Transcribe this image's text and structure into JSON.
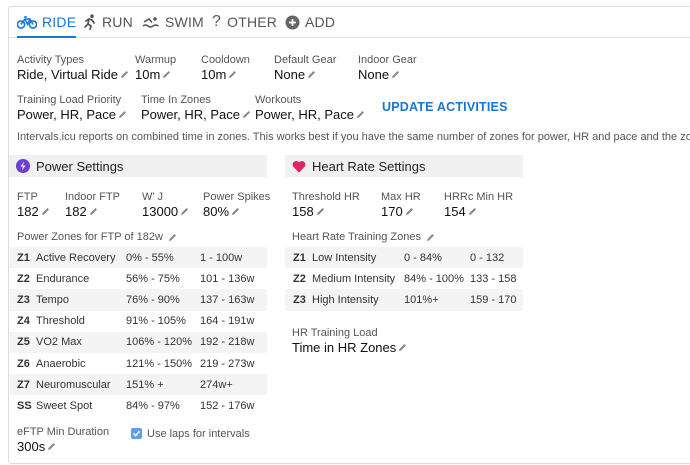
{
  "tabs": [
    {
      "label": "RIDE",
      "icon": "bike-icon",
      "active": true
    },
    {
      "label": "RUN",
      "icon": "run-icon",
      "active": false
    },
    {
      "label": "SWIM",
      "icon": "swim-icon",
      "active": false
    },
    {
      "label": "OTHER",
      "icon": "question-icon",
      "active": false
    },
    {
      "label": "ADD",
      "icon": "add-circle-icon",
      "active": false
    }
  ],
  "settings": {
    "activity_types": {
      "label": "Activity Types",
      "value": "Ride, Virtual Ride"
    },
    "warmup": {
      "label": "Warmup",
      "value": "10m"
    },
    "cooldown": {
      "label": "Cooldown",
      "value": "10m"
    },
    "default_gear": {
      "label": "Default Gear",
      "value": "None"
    },
    "indoor_gear": {
      "label": "Indoor Gear",
      "value": "None"
    },
    "training_load_priority": {
      "label": "Training Load Priority",
      "value": "Power, HR, Pace"
    },
    "time_in_zones": {
      "label": "Time In Zones",
      "value": "Power, HR, Pace"
    },
    "workouts": {
      "label": "Workouts",
      "value": "Power, HR, Pace"
    },
    "update_button": "UPDATE ACTIVITIES",
    "info_text": "Intervals.icu reports on combined time in zones. This works best if you have the same number of zones for power, HR and pace and the zones are cor"
  },
  "power": {
    "title": "Power Settings",
    "ftp": {
      "label": "FTP",
      "value": "182"
    },
    "indoor_ftp": {
      "label": "Indoor FTP",
      "value": "182"
    },
    "w_prime": {
      "label": "W' J",
      "value": "13000"
    },
    "power_spikes": {
      "label": "Power Spikes",
      "value": "80%"
    },
    "zones_label": "Power Zones for FTP of 182w",
    "zones": [
      {
        "id": "Z1",
        "name": "Active Recovery",
        "pct": "0% - 55%",
        "watts": "1 - 100w"
      },
      {
        "id": "Z2",
        "name": "Endurance",
        "pct": "56% - 75%",
        "watts": "101 - 136w"
      },
      {
        "id": "Z3",
        "name": "Tempo",
        "pct": "76% - 90%",
        "watts": "137 - 163w"
      },
      {
        "id": "Z4",
        "name": "Threshold",
        "pct": "91% - 105%",
        "watts": "164 - 191w"
      },
      {
        "id": "Z5",
        "name": "VO2 Max",
        "pct": "106% - 120%",
        "watts": "192 - 218w"
      },
      {
        "id": "Z6",
        "name": "Anaerobic",
        "pct": "121% - 150%",
        "watts": "219 - 273w"
      },
      {
        "id": "Z7",
        "name": "Neuromuscular",
        "pct": "151% +",
        "watts": "274w+"
      },
      {
        "id": "SS",
        "name": "Sweet Spot",
        "pct": "84% - 97%",
        "watts": "152 - 176w"
      }
    ],
    "eftp": {
      "label": "eFTP Min Duration",
      "value": "300s"
    },
    "use_laps": {
      "label": "Use laps for intervals",
      "checked": true
    }
  },
  "hr": {
    "title": "Heart Rate Settings",
    "threshold": {
      "label": "Threshold HR",
      "value": "158"
    },
    "max": {
      "label": "Max HR",
      "value": "170"
    },
    "hrrc": {
      "label": "HRRc Min HR",
      "value": "154"
    },
    "zones_label": "Heart Rate Training Zones",
    "zones": [
      {
        "id": "Z1",
        "name": "Low Intensity",
        "pct": "0 - 84%",
        "bpm": "0 - 132"
      },
      {
        "id": "Z2",
        "name": "Medium Intensity",
        "pct": "84% - 100%",
        "bpm": "133 - 158"
      },
      {
        "id": "Z3",
        "name": "High Intensity",
        "pct": "101%+",
        "bpm": "159 - 170"
      }
    ],
    "training_load": {
      "label": "HR Training Load",
      "value": "Time in HR Zones"
    }
  },
  "colors": {
    "accent": "#1976d2",
    "heart": "#e0245e",
    "bolt": "#6b3fd4",
    "section_bg": "#f0f0f0"
  }
}
